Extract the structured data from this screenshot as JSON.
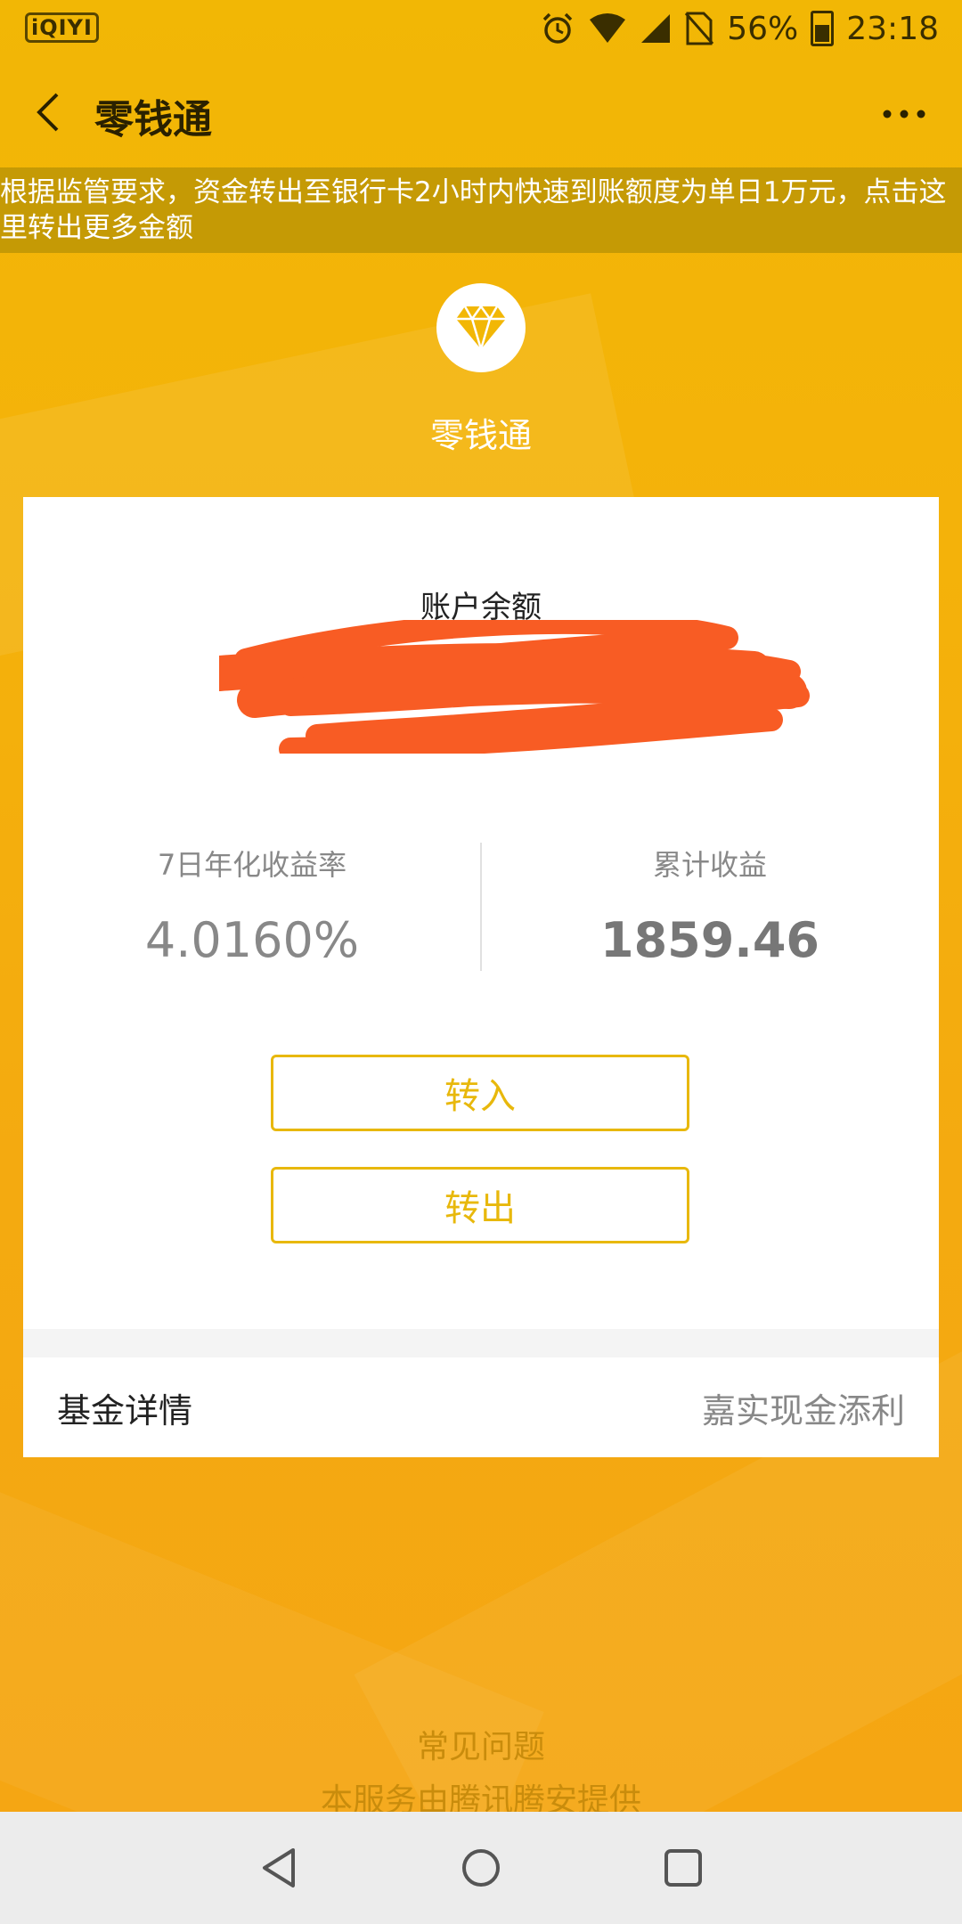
{
  "status_bar": {
    "app_badge": "iQIYI",
    "battery_percent": "56%",
    "time": "23:18"
  },
  "app_bar": {
    "title": "零钱通"
  },
  "notice": {
    "text": "根据监管要求，资金转出至银行卡2小时内快速到账额度为单日1万元，点击这里转出更多金额"
  },
  "header": {
    "product_name": "零钱通"
  },
  "account": {
    "balance_label": "账户余额",
    "yield_label": "7日年化收益率",
    "yield_value": "4.0160%",
    "cumulative_label": "累计收益",
    "cumulative_value": "1859.46"
  },
  "actions": {
    "transfer_in": "转入",
    "transfer_out": "转出"
  },
  "fund": {
    "label": "基金详情",
    "value": "嘉实现金添利"
  },
  "footer": {
    "faq": "常见问题",
    "provider": "本服务由腾讯腾安提供"
  },
  "colors": {
    "accent": "#e8b80c",
    "background": "#f3ae08",
    "redaction": "#f85c24"
  }
}
